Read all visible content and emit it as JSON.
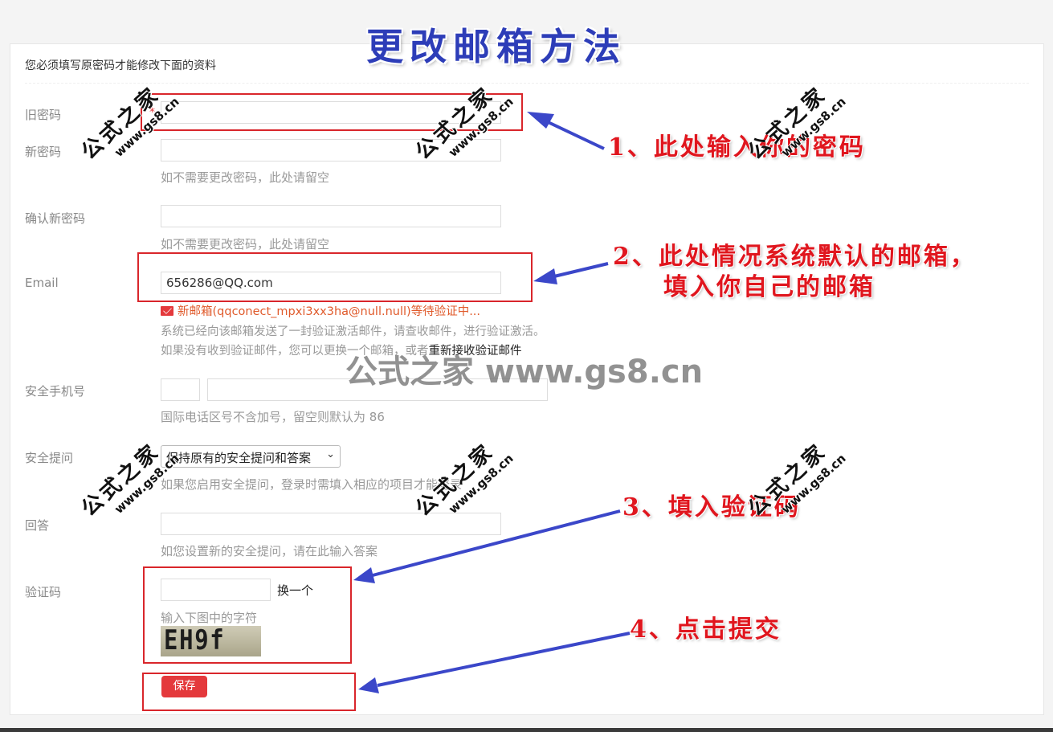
{
  "title": "更改邮箱方法",
  "form": {
    "notice": "您必须填写原密码才能修改下面的资料",
    "old_password": {
      "label": "旧密码",
      "required_mark": "*",
      "value": ""
    },
    "new_password": {
      "label": "新密码",
      "value": "",
      "hint": "如不需要更改密码，此处请留空"
    },
    "confirm_password": {
      "label": "确认新密码",
      "value": "",
      "hint": "如不需要更改密码，此处请留空"
    },
    "email": {
      "label": "Email",
      "value": "656286@QQ.com",
      "pending_text": "新邮箱(qqconect_mpxi3xx3ha@null.null)等待验证中...",
      "sent_text": "系统已经向该邮箱发送了一封验证激活邮件，请查收邮件，进行验证激活。",
      "resend_prefix": "如果没有收到验证邮件，您可以更换一个邮箱，或者",
      "resend_link": "重新接收验证邮件"
    },
    "phone": {
      "label": "安全手机号",
      "code": "",
      "number": "",
      "hint": "国际电话区号不含加号，留空则默认为 86"
    },
    "security_question": {
      "label": "安全提问",
      "selected": "保持原有的安全提问和答案",
      "hint": "如果您启用安全提问，登录时需填入相应的项目才能登录"
    },
    "answer": {
      "label": "回答",
      "value": "",
      "hint": "如您设置新的安全提问，请在此输入答案"
    },
    "captcha": {
      "label": "验证码",
      "value": "",
      "refresh_label": "换一个",
      "hint": "输入下图中的字符",
      "image_text": "EH9f"
    },
    "save_label": "保存"
  },
  "annotations": {
    "step1": "1、此处输入你的密码",
    "step2_line1": "2、此处情况系统默认的邮箱，",
    "step2_line2": "填入你自己的邮箱",
    "step3": "3、填入验证码",
    "step4": "4、点击提交"
  },
  "watermark": {
    "cn": "公式之家",
    "url": "www.gs8.cn",
    "center": "公式之家 www.gs8.cn"
  },
  "colors": {
    "accent": "#e4393c",
    "annotation": "#e0161e",
    "arrow": "#3b47c9",
    "title": "#2d3db8"
  }
}
